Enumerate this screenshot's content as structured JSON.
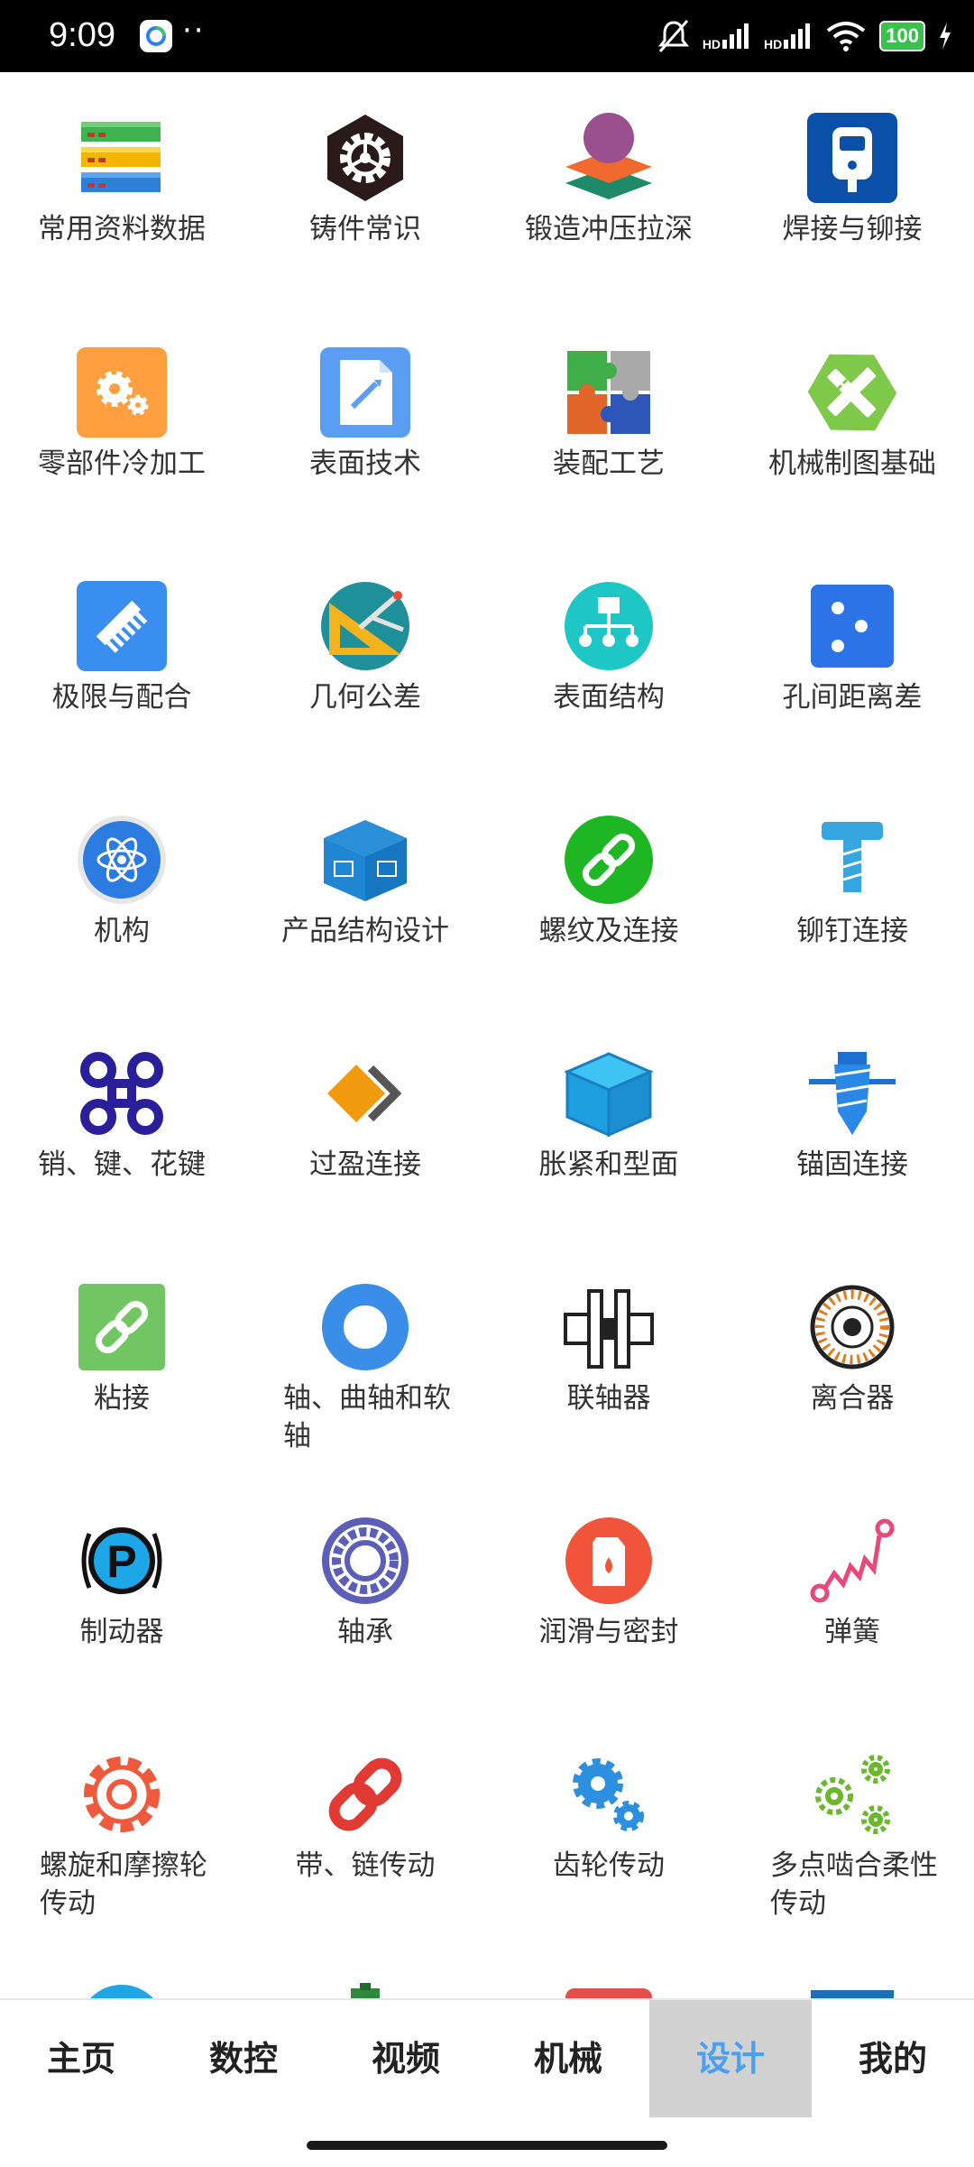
{
  "status_bar": {
    "time": "9:09",
    "dots": "··",
    "battery": "100"
  },
  "grid_items": [
    {
      "label": "常用资料数据",
      "icon": "database-icon"
    },
    {
      "label": "铸件常识",
      "icon": "gear-hexagon-icon"
    },
    {
      "label": "锻造冲压拉深",
      "icon": "layers-icon"
    },
    {
      "label": "焊接与铆接",
      "icon": "welding-meter-icon"
    },
    {
      "label": "零部件冷加工",
      "icon": "gears-icon"
    },
    {
      "label": "表面技术",
      "icon": "document-edit-icon"
    },
    {
      "label": "装配工艺",
      "icon": "puzzle-icon"
    },
    {
      "label": "机械制图基础",
      "icon": "ruler-pencil-icon"
    },
    {
      "label": "极限与配合",
      "icon": "comb-icon"
    },
    {
      "label": "几何公差",
      "icon": "compass-triangle-icon"
    },
    {
      "label": "表面结构",
      "icon": "hierarchy-icon"
    },
    {
      "label": "孔间距离差",
      "icon": "dots-icon"
    },
    {
      "label": "机构",
      "icon": "atom-icon"
    },
    {
      "label": "产品结构设计",
      "icon": "product-box-icon"
    },
    {
      "label": "螺纹及连接",
      "icon": "link-circle-icon"
    },
    {
      "label": "铆钉连接",
      "icon": "rivet-icon"
    },
    {
      "label": "销、键、花键",
      "icon": "command-key-icon"
    },
    {
      "label": "过盈连接",
      "icon": "interlock-diamond-icon"
    },
    {
      "label": "胀紧和型面",
      "icon": "cube-icon"
    },
    {
      "label": "锚固连接",
      "icon": "anchor-screw-icon"
    },
    {
      "label": "粘接",
      "icon": "link-square-icon"
    },
    {
      "label": "轴、曲轴和软轴",
      "icon": "ring-icon"
    },
    {
      "label": "联轴器",
      "icon": "coupling-icon"
    },
    {
      "label": "离合器",
      "icon": "clutch-disc-icon"
    },
    {
      "label": "制动器",
      "icon": "parking-brake-icon"
    },
    {
      "label": "轴承",
      "icon": "bearing-icon"
    },
    {
      "label": "润滑与密封",
      "icon": "oil-can-icon"
    },
    {
      "label": "弹簧",
      "icon": "spring-icon"
    },
    {
      "label": "螺旋和摩擦轮传动",
      "icon": "cog-outline-icon"
    },
    {
      "label": "带、链传动",
      "icon": "chain-icon"
    },
    {
      "label": "齿轮传动",
      "icon": "gear-pair-icon"
    },
    {
      "label": "多点啮合柔性传动",
      "icon": "multi-gear-icon"
    }
  ],
  "bottom_nav": [
    {
      "label": "主页"
    },
    {
      "label": "数控"
    },
    {
      "label": "视频"
    },
    {
      "label": "机械"
    },
    {
      "label": "设计",
      "active": true
    },
    {
      "label": "我的"
    }
  ],
  "colors": {
    "active_tab": "#4a9ff0",
    "active_tab_bg": "#d2d2d2"
  }
}
